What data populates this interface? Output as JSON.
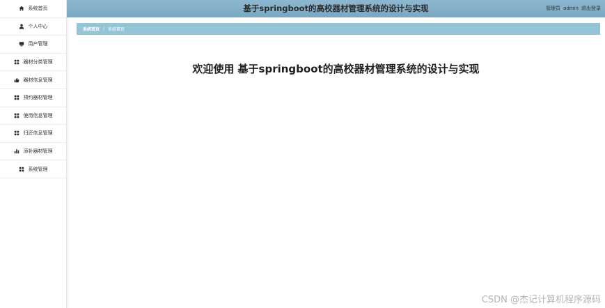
{
  "sidebar": {
    "items": [
      {
        "label": "系统首页",
        "icon": "home-icon"
      },
      {
        "label": "个人中心",
        "icon": "user-icon"
      },
      {
        "label": "用户管理",
        "icon": "monitor-icon"
      },
      {
        "label": "器材分类管理",
        "icon": "grid-icon"
      },
      {
        "label": "器材信息管理",
        "icon": "thumbs-up-icon"
      },
      {
        "label": "预约器材管理",
        "icon": "grid-icon"
      },
      {
        "label": "使用信息管理",
        "icon": "grid-icon"
      },
      {
        "label": "归还信息管理",
        "icon": "grid-icon"
      },
      {
        "label": "添补器材管理",
        "icon": "bar-chart-icon"
      },
      {
        "label": "系统管理",
        "icon": "grid-icon"
      }
    ]
  },
  "header": {
    "title": "基于springboot的高校器材管理系统的设计与实现",
    "role_label": "管理员",
    "username": "admin",
    "logout_label": "退出登录"
  },
  "breadcrumb": {
    "first": "系统首页",
    "separator": "/",
    "current": "系统首页"
  },
  "main": {
    "welcome_text": "欢迎使用 基于springboot的高校器材管理系统的设计与实现"
  },
  "watermark": "CSDN @杰记计算机程序源码",
  "colors": {
    "header_bg": "#7aa8c3",
    "breadcrumb_bg": "#94c5d6",
    "sidebar_bg": "#ffffff"
  }
}
